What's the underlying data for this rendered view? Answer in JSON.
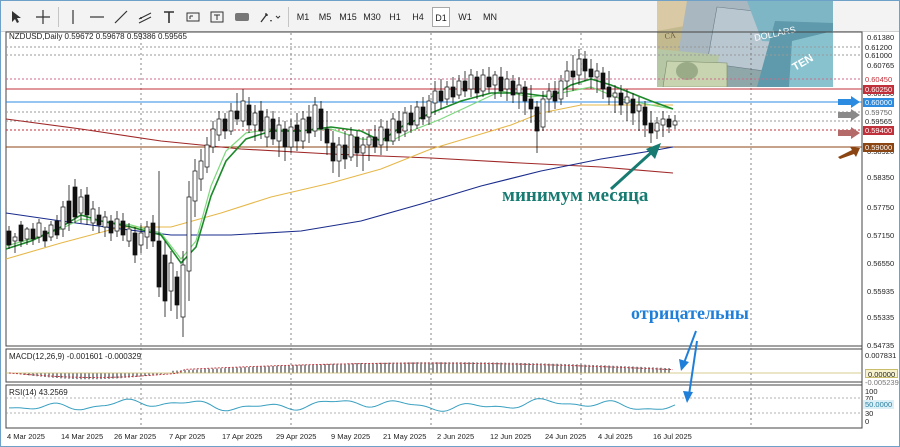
{
  "toolbar": {
    "timeframes": [
      "M1",
      "M5",
      "M15",
      "M30",
      "H1",
      "H4",
      "D1",
      "W1",
      "MN"
    ],
    "active_timeframe": "D1"
  },
  "chart": {
    "info": "NZDUSD,Daily  0.59672 0.59678 0.59386 0.59565",
    "price_axis": [
      "0.61380",
      "0.60765",
      "0.60150",
      "0.59535",
      "0.58920",
      "0.58350",
      "0.57750",
      "0.57150",
      "0.56550",
      "0.55935",
      "0.55335",
      "0.54735"
    ],
    "price_labels": [
      {
        "text": "0.61200",
        "bg": "#ffffff",
        "color": "#222222"
      },
      {
        "text": "0.61000",
        "bg": "#ffffff",
        "color": "#222222"
      },
      {
        "text": "0.60450",
        "bg": "#ffffff",
        "color": "#c0303a"
      },
      {
        "text": "0.60250",
        "bg": "#c0303a",
        "color": "#ffffff"
      },
      {
        "text": "0.60000",
        "bg": "#2b8be0",
        "color": "#ffffff"
      },
      {
        "text": "0.59750",
        "bg": "#ffffff",
        "color": "#666666"
      },
      {
        "text": "0.59565",
        "bg": "#ffffff",
        "color": "#222222"
      },
      {
        "text": "0.59400",
        "bg": "#c0303a",
        "color": "#ffffff"
      },
      {
        "text": "0.59000",
        "bg": "#8b4513",
        "color": "#ffffff"
      }
    ]
  },
  "annotations": {
    "month_low": "минимум месяца",
    "negative": "отрицательны"
  },
  "macd": {
    "label": "MACD(12,26,9) -0.001601 -0.000329",
    "axis": [
      "0.007831",
      "0.00000",
      "-0.005239"
    ]
  },
  "rsi": {
    "label": "RSI(14) 43.2569",
    "axis": [
      "100",
      "70",
      "50.0000",
      "30",
      "0"
    ]
  },
  "date_axis": [
    "4 Mar 2025",
    "14 Mar 2025",
    "26 Mar 2025",
    "7 Apr 2025",
    "17 Apr 2025",
    "29 Apr 2025",
    "9 May 2025",
    "21 May 2025",
    "2 Jun 2025",
    "12 Jun 2025",
    "24 Jun 2025",
    "4 Jul 2025",
    "16 Jul 2025"
  ],
  "colors": {
    "bull": "#ffffff",
    "bear": "#111111",
    "fast_ma": "#1c8a2a",
    "slow_ma": "#e6b84a",
    "ma_long_blue": "#1a2c8c",
    "ma_long_red": "#a02828",
    "annotation_teal": "#177b72",
    "annotation_blue": "#1f7fd8",
    "macd_signal": "#c0303a",
    "rsi_line": "#3aa0c0"
  },
  "icons": [
    "cursor-icon",
    "crosshair-icon",
    "vertical-line-icon",
    "horizontal-line-icon",
    "trendline-icon",
    "channel-icon",
    "text-icon",
    "label-icon",
    "shapes-icon",
    "arrows-icon"
  ]
}
